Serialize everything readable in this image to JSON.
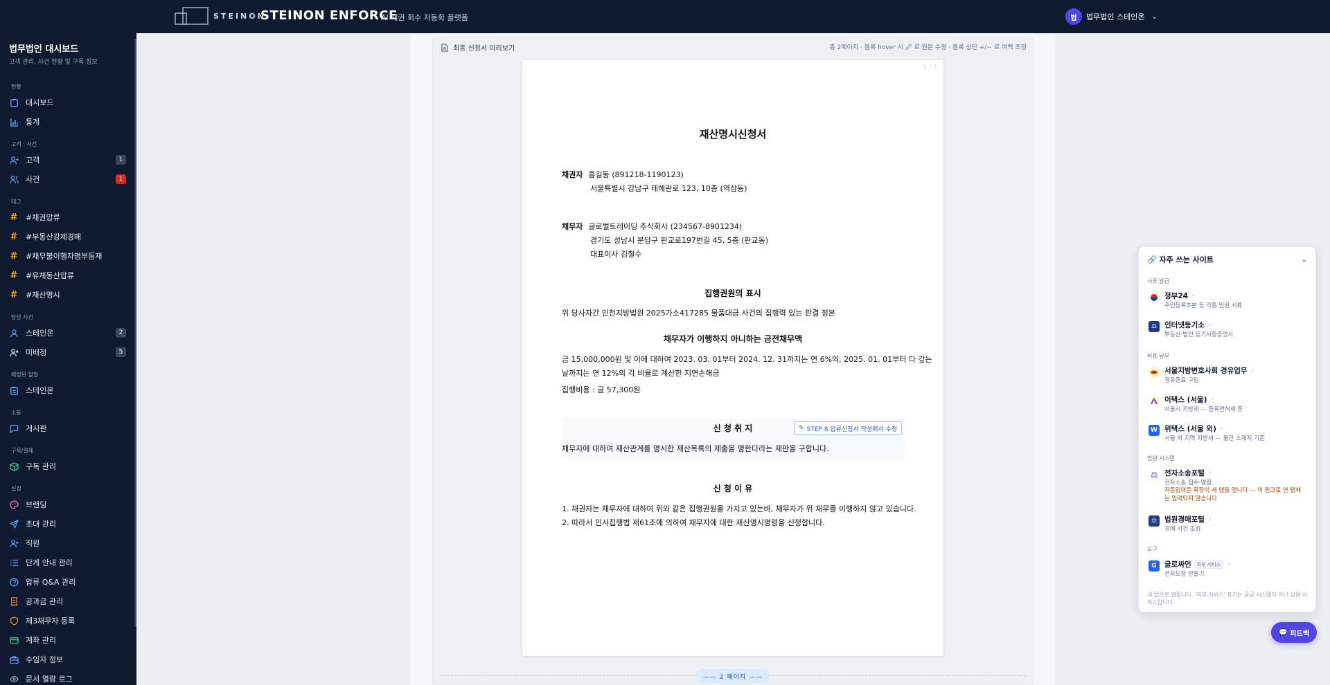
{
  "header": {
    "brand_small": "STEINON",
    "brand_big": "STEINON ENFORCE",
    "brand_sub": "AI 채권 회수 자동화 플랫폼",
    "user_initial": "법",
    "user_name": "법무법인 스테인온"
  },
  "sidebar": {
    "title": "법무법인 대시보드",
    "subtitle": "고객 관리, 사건 현황 및 구독 정보",
    "sections": {
      "status": "현황",
      "clients_cases": "고객 · 사건",
      "tags": "태그",
      "assigned_cases": "담당 사건",
      "assigned_jobs": "배정된 할일",
      "community": "소통",
      "billing": "구독/결제",
      "settings": "설정"
    },
    "items": {
      "dashboard": "대시보드",
      "stats": "통계",
      "clients": "고객",
      "clients_count": "1",
      "cases": "사건",
      "cases_count": "1",
      "tag1": "#채권압류",
      "tag2": "#부동산강제경매",
      "tag3": "#채무불이행자명부등재",
      "tag4": "#유체동산압류",
      "tag5": "#재산명시",
      "assigned_steinon": "스테인온",
      "assigned_steinon_count": "2",
      "unassigned": "미배정",
      "unassigned_count": "5",
      "job_steinon": "스테인온",
      "board": "게시판",
      "subscription": "구독 관리",
      "branding": "브랜딩",
      "invites": "초대 관리",
      "staff": "직원",
      "step_guide": "단계 안내 관리",
      "qa": "압류 Q&A 관리",
      "fees": "공과금 관리",
      "third_party": "제3채무자 등록",
      "accounts": "계좌 관리",
      "recipients": "수임자 정보",
      "doc_logs": "문서 열람 로그"
    }
  },
  "preview": {
    "header": "최종 신청서 미리보기",
    "hint": "총 2페이지 · 블록 hover 시 🖉 로 원본 수정 · 블록 상단 +/− 로 여백 조정",
    "page_indicator": "1 / 2",
    "page_separator": "—— 2 페이지 ——"
  },
  "document": {
    "title": "재산명시신청서",
    "creditor_label": "채권자",
    "creditor_name": "홍길동 (891218-1190123)",
    "creditor_address": "서울특별시 강남구 테헤란로 123, 10층 (역삼동)",
    "debtor_label": "채무자",
    "debtor_name": "글로벌트레이딩 주식회사 (234567-8901234)",
    "debtor_address": "경기도 성남시 분당구 판교로197번길 45, 5층 (판교동)",
    "debtor_rep": "대표이사 김철수",
    "section_title_writ": "집행권원의 표시",
    "writ_text": "위 당사자간 인천지방법원 2025가소417285 물품대금 사건의 집행력 있는 판결 정본",
    "section_title_debt": "채무자가 이행하지 아니하는 금전채무액",
    "debt_line1": "금 15,000,000원 및 이에 대하여 2023. 03. 01부터 2024. 12. 31까지는 연 6%의, 2025. 01. 01부터 다 갚는",
    "debt_line2": "날까지는 연 12%의 각 비율로 계산한 지연손해금",
    "exec_cost": "집행비용 : 금 57,300원",
    "section_title_claim": "신 청 취 지",
    "edit_button": "STEP 8 압류신청서 작성에서 수정",
    "claim_text": "채무자에 대하여 재산관계를 명시한 재산목록의 제출을 명한다라는 재판을 구합니다.",
    "section_title_reason": "신 청 이 유",
    "reason1": "1. 채권자는 채무자에 대하여 위와 같은 집행권원을 가지고 있는바, 채무자가 위 채무를 이행하지 않고 있습니다.",
    "reason2": "2. 따라서 민사집행법 제61조에 의하여 채무자에 대한 재산명시명령을 신청합니다."
  },
  "sites": {
    "title": "🔗 자주 쓰는 사이트",
    "cat_docs": "서류 발급",
    "cat_fees": "비용 납부",
    "cat_court": "법원 시스템",
    "cat_tools": "도구",
    "gov24_name": "정부24",
    "gov24_desc": "주민등록초본 등 각종 민원 서류",
    "iros_name": "인터넷등기소",
    "iros_desc": "부동산·법인 등기사항증명서",
    "bar_name": "서울지방변호사회 경유업무",
    "bar_desc": "경유증표 구입",
    "etax_name": "이택스 (서울)",
    "etax_desc": "서울시 지방세 — 등록면허세 등",
    "wetax_name": "위택스 (서울 외)",
    "wetax_desc": "서울 외 지역 지방세 — 물건 소재지 기준",
    "ecourt_name": "전자소송포털",
    "ecourt_desc": "전자소송 접수·열람",
    "ecourt_warn": "자동입력은 확장이 새 탭을 엽니다 — 이 링크로 연 탭에는 입력되지 않습니다",
    "auction_name": "법원경매포털",
    "auction_desc": "경매 사건 조회",
    "glosign_name": "글로싸인",
    "glosign_tag": "외부 서비스",
    "glosign_desc": "전자도장 만들기",
    "footer": "새 탭으로 열립니다. '외부 서비스' 표기는 공공 시스템이 아닌 상용 서비스입니다."
  },
  "feedback": {
    "label": "피드백"
  },
  "colors": {
    "nav_bg": "#0f1a30",
    "accent": "#4f46e5",
    "tag_hash": "#f59e0b",
    "badge_red": "#dc2626",
    "link_blue": "#2563eb"
  }
}
